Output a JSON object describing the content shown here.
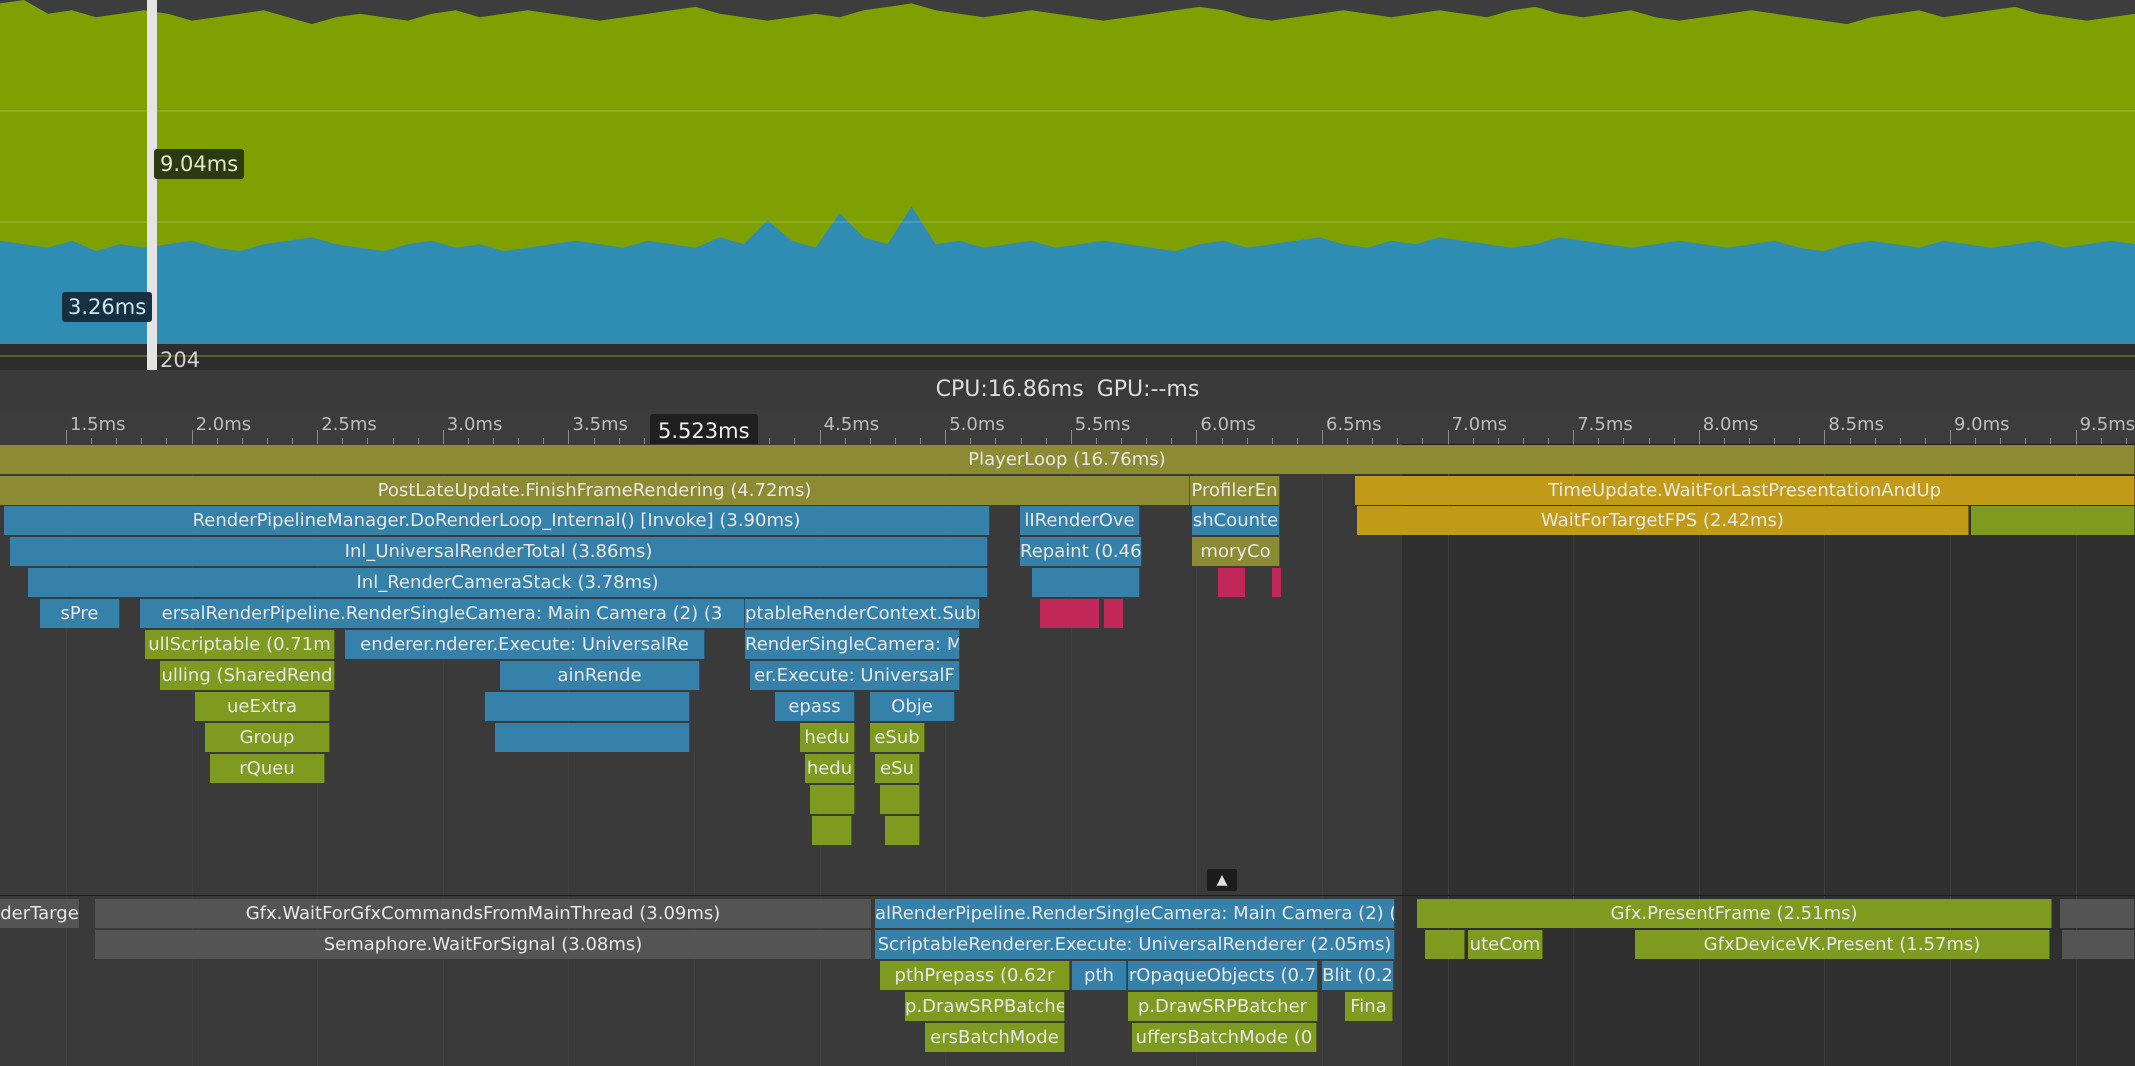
{
  "colors": {
    "gpu_area": "#7ea000",
    "cpu_area": "#2f8cb3",
    "chart_bg": "#3d3d3d",
    "main_thread_bar": "#8c8a32",
    "wait_bar": "#c19b18",
    "render_bar": "#3581a9",
    "script_bar": "#7f9b1f",
    "idle_bar": "#545454",
    "gc_bar": "#c0285a"
  },
  "chart": {
    "selected_frame": "204",
    "gpu_time_label": "9.04ms",
    "cpu_time_label": "3.26ms",
    "chart_data": {
      "type": "area",
      "series": [
        {
          "values": [
            99,
            100,
            96,
            97,
            95,
            96,
            97,
            96,
            94,
            95,
            96,
            97,
            95,
            93,
            95,
            96,
            95,
            94,
            96,
            97,
            95,
            96,
            97,
            96,
            95,
            94,
            95,
            96,
            97,
            98,
            96,
            95,
            94,
            95,
            96,
            95,
            97,
            98,
            99,
            97,
            96,
            95,
            96,
            97,
            96,
            95,
            94,
            95,
            96,
            97,
            98,
            97,
            95,
            94,
            95,
            96,
            97,
            96,
            95,
            96,
            97,
            96,
            95,
            97,
            98,
            96,
            95,
            96,
            97,
            95,
            94,
            95,
            96,
            97,
            96,
            95,
            94,
            93,
            95,
            96,
            97,
            95,
            96,
            97,
            98,
            96,
            95,
            94,
            95,
            96
          ]
        },
        {
          "values": [
            30,
            29,
            28,
            30,
            27,
            29,
            28,
            29,
            30,
            28,
            27,
            29,
            30,
            31,
            29,
            28,
            27,
            29,
            30,
            28,
            29,
            27,
            28,
            29,
            30,
            29,
            28,
            30,
            29,
            28,
            31,
            29,
            36,
            30,
            28,
            38,
            31,
            29,
            40,
            29,
            30,
            28,
            29,
            30,
            28,
            29,
            30,
            29,
            28,
            27,
            29,
            30,
            28,
            29,
            30,
            31,
            29,
            28,
            30,
            29,
            31,
            30,
            29,
            28,
            29,
            31,
            30,
            29,
            28,
            29,
            30,
            29,
            28,
            29,
            30,
            28,
            27,
            29,
            30,
            29,
            28,
            30,
            29,
            28,
            29,
            30,
            28,
            29,
            30,
            29
          ]
        }
      ],
      "ylim": [
        0,
        100
      ]
    }
  },
  "summary": {
    "cpu": "CPU:16.86ms",
    "gpu": "GPU:--ms"
  },
  "ruler": {
    "ticks": [
      "1.5ms",
      "2.0ms",
      "2.5ms",
      "3.0ms",
      "3.5ms",
      "4.0ms",
      "4.5ms",
      "5.0ms",
      "5.5ms",
      "6.0ms",
      "6.5ms",
      "7.0ms",
      "7.5ms",
      "8.0ms",
      "8.5ms",
      "9.0ms",
      "9.5ms"
    ],
    "marker": "5.523ms"
  },
  "main_thread": {
    "player_loop": "PlayerLoop (16.76ms)",
    "post_late_update": "PostLateUpdate.FinishFrameRendering (4.72ms)",
    "profiler_end": "ProfilerEn",
    "time_update": "TimeUpdate.WaitForLastPresentationAndUp",
    "render_loop": "RenderPipelineManager.DoRenderLoop_Internal() [Invoke] (3.90ms)",
    "ui_render_overlay": "lIRenderOve",
    "finish_counters": "shCounte",
    "wait_for_target_fps": "WaitForTargetFPS (2.42ms)",
    "urp_render_total": "Inl_UniversalRenderTotal (3.86ms)",
    "repaint": "Repaint (0.46",
    "memory_counters": "moryCo",
    "render_camera_stack": "Inl_RenderCameraStack (3.78ms)",
    "render_single_camera": "ersalRenderPipeline.RenderSingleCamera: Main Camera (2) (3",
    "context_submit": "ptableRenderContext.Submit (",
    "small_left": "sPre",
    "cull_scriptable": "ullScriptable (0.71m",
    "renderer_execute": "enderer.nderer.Execute: UniversalRe",
    "render_single_camera_b": "RenderSingleCamera: M",
    "culling": "ulling (SharedRend",
    "main_render": "ainRende",
    "renderer_execute_b": "er.Execute: UniversalF",
    "queue_extract": "ueExtra",
    "prepass": "epass",
    "objects": "Obje",
    "group": "Group",
    "schedule_a": "hedu",
    "schedule_b": "eSub",
    "render_queue": "rQueu",
    "schedule_c": "hedu",
    "schedule_d": "eSu"
  },
  "render_thread": {
    "wait_target": "derTarge",
    "wait_gfx_commands": "Gfx.WaitForGfxCommandsFromMainThread (3.09ms)",
    "rt_render_single_camera": "alRenderPipeline.RenderSingleCamera: Main Camera (2) (",
    "present_frame": "Gfx.PresentFrame (2.51ms)",
    "semaphore": "Semaphore.WaitForSignal (3.08ms)",
    "rt_renderer_execute": "ScriptableRenderer.Execute: UniversalRenderer (2.05ms)",
    "execute_com": "uteCom",
    "device_present": "GfxDeviceVK.Present (1.57ms)",
    "depth_prepass": "pthPrepass (0.62r",
    "depth": "pth",
    "opaque_objects": "rOpaqueObjects (0.7",
    "blit": "Blit (0.2",
    "draw_srp_batcher_a": "p.DrawSRPBatche",
    "draw_srp_batcher_b": "p.DrawSRPBatcher",
    "final": "Fina",
    "buffers_batch_a": "ersBatchMode",
    "buffers_batch_b": "uffersBatchMode (0"
  }
}
